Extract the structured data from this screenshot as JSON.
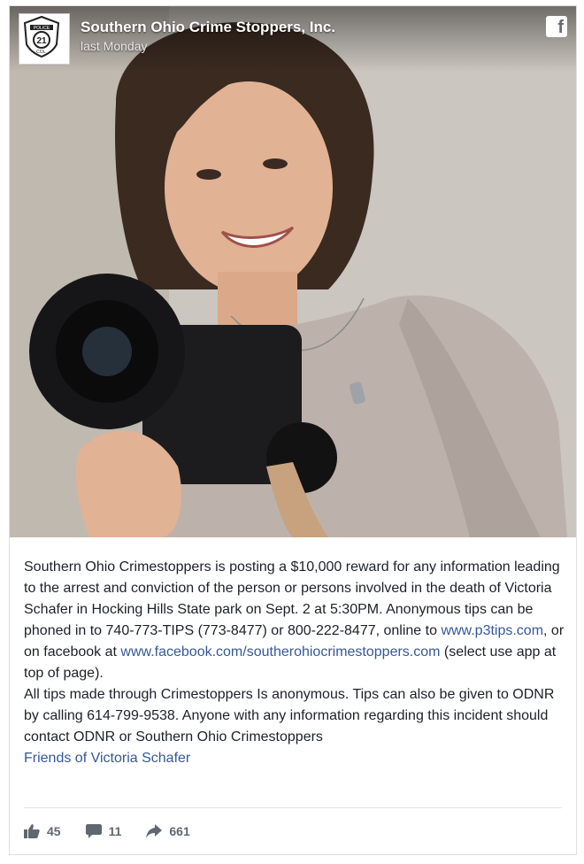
{
  "post": {
    "page_name": "Southern Ohio Crime Stoppers, Inc.",
    "time": "last Monday",
    "avatar": {
      "badge_top": "POLICE",
      "badge_number": "21",
      "badge_bottom": "COL."
    },
    "brand_icon": "facebook-icon",
    "photo_alt": "Portrait of a smiling woman holding a camera"
  },
  "body": {
    "p1_before": "Southern Ohio Crimestoppers is posting a $10,000 reward for any information leading to the arrest and conviction of the person or persons involved in the death of Victoria Schafer in Hocking Hills State park on Sept. 2 at 5:30PM. Anonymous tips can be phoned in to 740-773-TIPS (773-8477) or 800-222-8477, online to ",
    "link1": "www.p3tips.com",
    "p1_middle": ", or on facebook at ",
    "link2": "www.facebook.com/southerohiocrimestoppers.com",
    "p1_after": " (select use app at top of page).",
    "p2": "All tips made through Crimestoppers Is anonymous. Tips can also be given to ODNR by calling 614-799-9538. Anyone with any information regarding this incident should contact ODNR or Southern Ohio Crimestoppers",
    "tag_link": "Friends of Victoria Schafer"
  },
  "actions": {
    "likes": "45",
    "comments": "11",
    "shares": "661",
    "icons": [
      "thumbs-up-icon",
      "comment-icon",
      "share-icon"
    ]
  },
  "colors": {
    "link": "#365899",
    "text": "#1d2129",
    "meta": "#606770"
  }
}
